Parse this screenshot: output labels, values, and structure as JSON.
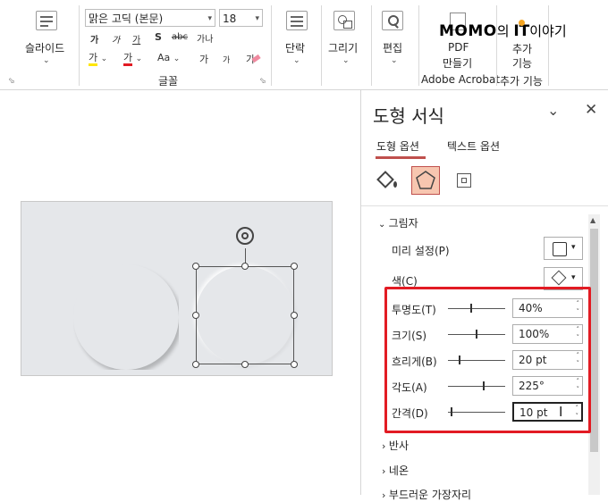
{
  "ribbon": {
    "slide_group": {
      "label": "슬라이드",
      "new_slide_icon": "new-slide-icon"
    },
    "font": {
      "family": "맑은 고딕 (본문)",
      "size": "18",
      "grow": "가",
      "shrink": "가",
      "format_a": "가",
      "strike_a": "abc",
      "case": "Aa",
      "shadow": "S",
      "spacing": "가나",
      "highlight": "가",
      "color": "가",
      "superscript": "가",
      "subscript": "가",
      "clear": "가",
      "group_label": "글꼴"
    },
    "paragraph": {
      "label": "단락"
    },
    "drawing": {
      "label": "그리기"
    },
    "editing": {
      "label": "편집"
    },
    "acrobat": {
      "pdf_line1": "PDF",
      "pdf_line2": "만들기",
      "group_label": "Adobe Acrobat"
    },
    "addins": {
      "line1": "추가",
      "line2": "기능",
      "group_label": "추가 기능"
    },
    "watermark": {
      "part1": "MOMO",
      "part2": "의 ",
      "part3": "IT",
      "part4": "이야기"
    },
    "colors": {
      "accent_red": "#e21b23",
      "watermark_dot": "#f5a623"
    }
  },
  "pane": {
    "title": "도형 서식",
    "tabs": [
      {
        "label": "도형 옵션",
        "active": true
      },
      {
        "label": "텍스트 옵션",
        "active": false
      }
    ],
    "sections": {
      "shadow": {
        "title": "그림자",
        "preset": "미리 설정(P)",
        "color": "색(C)",
        "rows": [
          {
            "label": "투명도(T)",
            "value": "40%",
            "level": 0.4
          },
          {
            "label": "크기(S)",
            "value": "100%",
            "level": 0.5
          },
          {
            "label": "흐리게(B)",
            "value": "20 pt",
            "level": 0.2
          },
          {
            "label": "각도(A)",
            "value": "225°",
            "level": 0.63
          },
          {
            "label": "간격(D)",
            "value": "10 pt",
            "level": 0.05
          }
        ]
      },
      "reflection": {
        "title": "반사"
      },
      "glow": {
        "title": "네온"
      },
      "soft_edges": {
        "title": "부드러운 가장자리"
      }
    },
    "icons": [
      "fill-line-icon",
      "effects-pentagon-icon",
      "size-properties-icon"
    ]
  }
}
